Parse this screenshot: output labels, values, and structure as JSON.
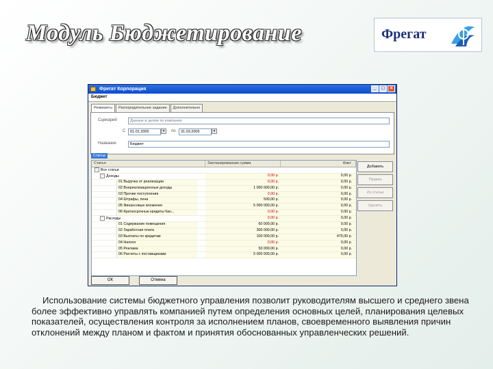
{
  "slide": {
    "title": "Модуль Бюджетирование",
    "logo_text": "Фрегат",
    "description": "Использование системы бюджетного управления позволит руководителям высшего и среднего звена более эффективно управлять компанией путем определения основных целей, планирования целевых показателей, осуществления контроля за исполнением планов, своевременного выявления причин отклонений между планом и фактом и принятия обоснованных управленческих решений."
  },
  "window": {
    "title": "Фрегат Корпорация",
    "subtitle": "Бюджет",
    "tabs": [
      "Реквизиты",
      "Распорядительное задание",
      "Дополнительно"
    ],
    "fields": {
      "scenario_label": "Сценарий",
      "scenario_value": "Данные в целом по компании",
      "period_from_label": "С",
      "period_from_value": "01.01.2005",
      "period_to_label": "по",
      "period_to_value": "31.03.2005",
      "name_label": "Название",
      "name_value": "Бюджет"
    },
    "section_label": "Статьи",
    "columns": [
      "Статья",
      "Запланированная сумма",
      "Факт"
    ],
    "rows": [
      {
        "name": "Все статьи",
        "indent": 0,
        "plan": "",
        "fact": "",
        "plan_red": false
      },
      {
        "name": "Доходы",
        "indent": 1,
        "plan": "0,00 р.",
        "fact": "0,00 р.",
        "plan_red": true
      },
      {
        "name": "01 Выручка от реализации",
        "indent": 2,
        "plan": "0,00 р.",
        "fact": "0,00 р.",
        "plan_red": true
      },
      {
        "name": "02 Внереализационные доходы",
        "indent": 2,
        "plan": "1 000 000,00 р.",
        "fact": "0,00 р.",
        "plan_red": false
      },
      {
        "name": "03 Прочие поступления",
        "indent": 2,
        "plan": "0,00 р.",
        "fact": "0,00 р.",
        "plan_red": true
      },
      {
        "name": "04 Штрафы, пени",
        "indent": 2,
        "plan": "500,00 р.",
        "fact": "0,00 р.",
        "plan_red": false
      },
      {
        "name": "05 Финансовые вложения",
        "indent": 2,
        "plan": "5 000 000,00 р.",
        "fact": "0,00 р.",
        "plan_red": false
      },
      {
        "name": "06 Краткосрочные кредиты бан...",
        "indent": 2,
        "plan": "0,00 р.",
        "fact": "0,00 р.",
        "plan_red": true
      },
      {
        "name": "Расходы",
        "indent": 1,
        "plan": "0,00 р.",
        "fact": "0,00 р.",
        "plan_red": true
      },
      {
        "name": "01 Содержание помещения",
        "indent": 2,
        "plan": "60 000,00 р.",
        "fact": "0,00 р.",
        "plan_red": false
      },
      {
        "name": "02 Заработная плата",
        "indent": 2,
        "plan": "300 000,00 р.",
        "fact": "0,00 р.",
        "plan_red": false
      },
      {
        "name": "03 Выплаты по кредитам",
        "indent": 2,
        "plan": "100 000,00 р.",
        "fact": "470,00 р.",
        "plan_red": false
      },
      {
        "name": "04 Налоги",
        "indent": 2,
        "plan": "0,00 р.",
        "fact": "0,00 р.",
        "plan_red": true
      },
      {
        "name": "05 Реклама",
        "indent": 2,
        "plan": "50 000,00 р.",
        "fact": "0,00 р.",
        "plan_red": false
      },
      {
        "name": "06 Расчеты с поставщиками",
        "indent": 2,
        "plan": "5 000 000,00 р.",
        "fact": "0,00 р.",
        "plan_red": false
      }
    ],
    "side_buttons": [
      "Добавить",
      "Правка",
      "Из статьи",
      "Удалить"
    ],
    "bottom_buttons": [
      "ОК",
      "Отмена"
    ]
  },
  "colors": {
    "titlebar": "#0a4ccf",
    "plan_negative": "#d00000",
    "logo_text": "#1b2f7a"
  }
}
